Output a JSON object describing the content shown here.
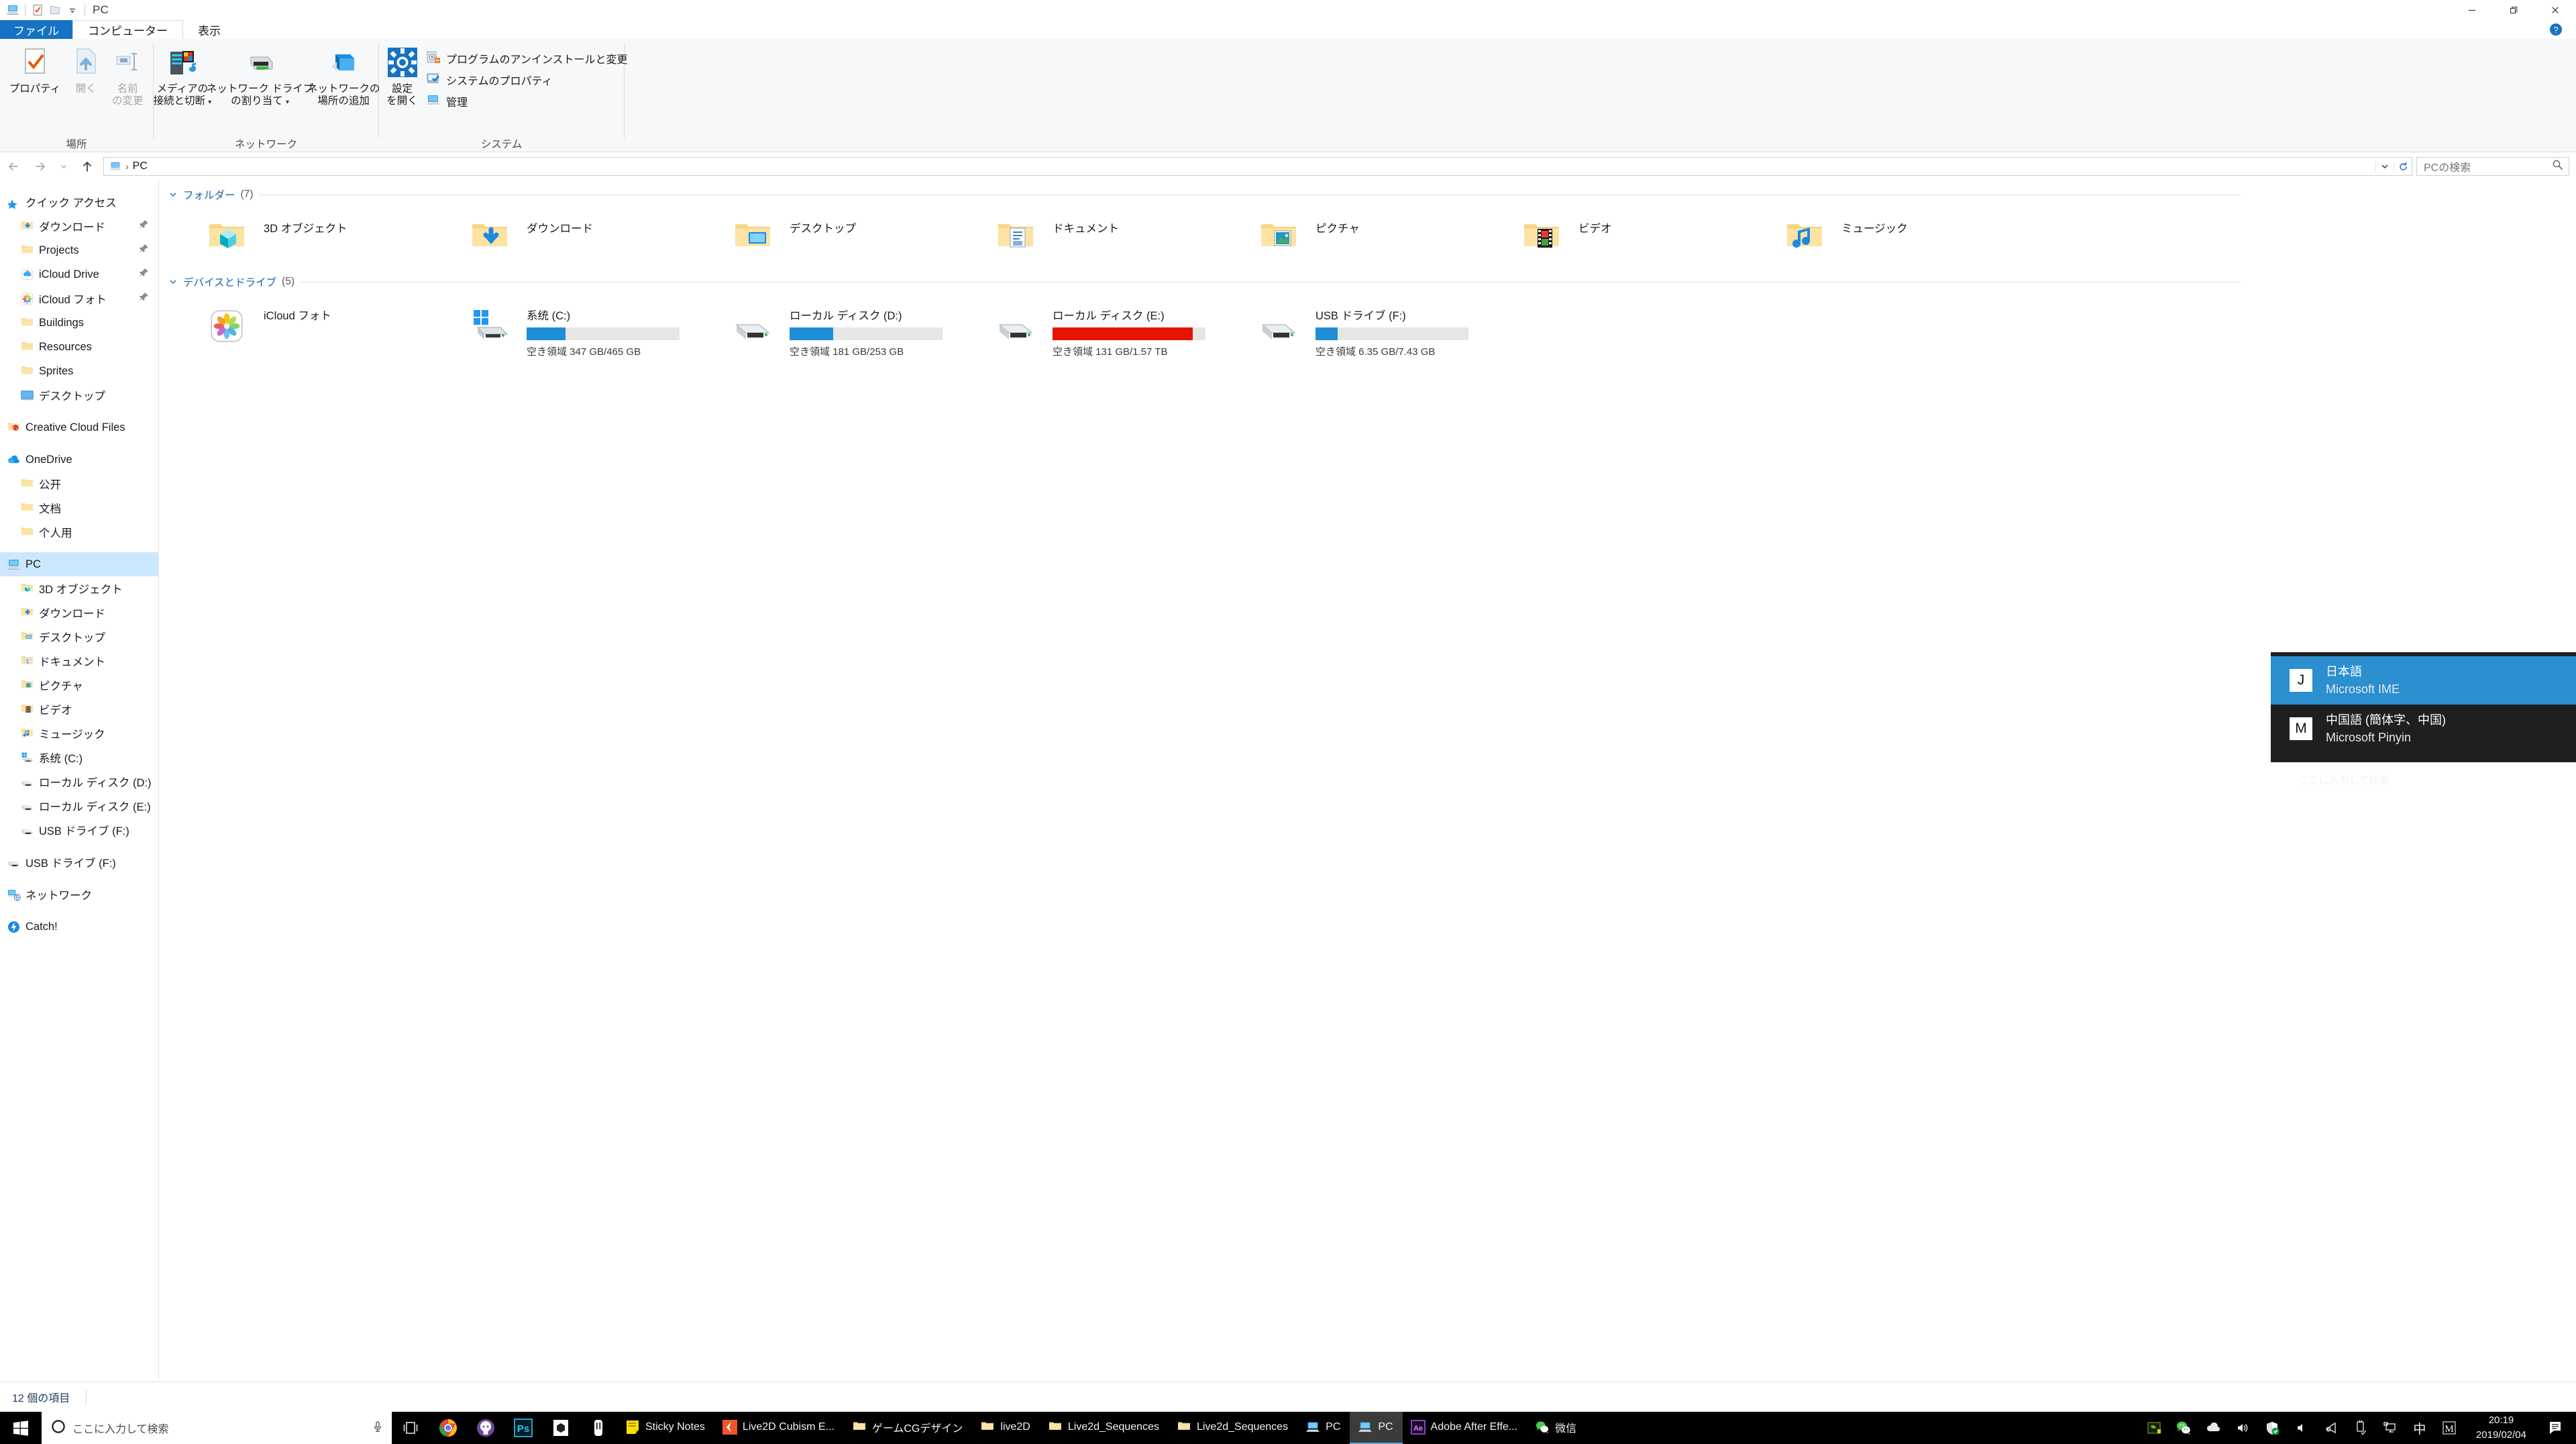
{
  "window": {
    "title": "PC",
    "quick_access_icons": [
      "pc-icon",
      "properties-icon",
      "folder-icon",
      "chevron-down-icon"
    ],
    "controls": {
      "minimize": "minimize-icon",
      "restore": "restore-icon",
      "close": "close-icon",
      "help": "help-icon"
    }
  },
  "ribbon": {
    "tabs": [
      {
        "label": "ファイル",
        "kind": "file"
      },
      {
        "label": "コンピューター",
        "kind": "active"
      },
      {
        "label": "表示",
        "kind": "normal"
      }
    ],
    "groups": [
      {
        "name": "場所",
        "buttons": [
          {
            "label_l1": "プロパティ",
            "label_l2": "",
            "icon": "properties-icon",
            "disabled": false
          },
          {
            "label_l1": "開く",
            "label_l2": "",
            "icon": "open-icon",
            "disabled": true
          },
          {
            "label_l1": "名前",
            "label_l2": "の変更",
            "icon": "rename-icon",
            "disabled": true
          }
        ]
      },
      {
        "name": "ネットワーク",
        "buttons": [
          {
            "label_l1": "メディアの",
            "label_l2": "接続と切断",
            "icon": "media-server-icon",
            "dropdown": true
          },
          {
            "label_l1": "ネットワーク ドライブ",
            "label_l2": "の割り当て",
            "icon": "network-drive-icon",
            "dropdown": true
          },
          {
            "label_l1": "ネットワークの",
            "label_l2": "場所の追加",
            "icon": "add-network-location-icon",
            "dropdown": false
          }
        ]
      },
      {
        "name": "システム",
        "big_button": {
          "label_l1": "設定",
          "label_l2": "を開く",
          "icon": "settings-gear-icon"
        },
        "small_buttons": [
          {
            "label": "プログラムのアンインストールと変更",
            "icon": "uninstall-program-icon"
          },
          {
            "label": "システムのプロパティ",
            "icon": "system-properties-icon"
          },
          {
            "label": "管理",
            "icon": "manage-computer-icon"
          }
        ]
      }
    ]
  },
  "addressbar": {
    "back": "back-arrow-icon",
    "forward": "forward-arrow-icon",
    "recent": "chevron-down-icon",
    "up": "up-arrow-icon",
    "breadcrumb_icon": "pc-icon",
    "breadcrumb": [
      "PC"
    ],
    "separator": "›",
    "dropdown": "chevron-down-icon",
    "refresh": "refresh-icon",
    "search_placeholder": "PCの検索",
    "search_icon": "search-icon"
  },
  "navpane": {
    "items": [
      {
        "label": "クイック アクセス",
        "icon": "quick-access-star-icon",
        "level": 0,
        "pinned": false,
        "selected": false
      },
      {
        "label": "ダウンロード",
        "icon": "downloads-folder-icon",
        "level": 1,
        "pinned": true,
        "selected": false
      },
      {
        "label": "Projects",
        "icon": "folder-icon",
        "level": 1,
        "pinned": true,
        "selected": false
      },
      {
        "label": "iCloud Drive",
        "icon": "icloud-drive-icon",
        "level": 1,
        "pinned": true,
        "selected": false
      },
      {
        "label": "iCloud フォト",
        "icon": "icloud-photos-icon",
        "level": 1,
        "pinned": true,
        "selected": false
      },
      {
        "label": "Buildings",
        "icon": "folder-icon",
        "level": 1,
        "pinned": false,
        "selected": false
      },
      {
        "label": "Resources",
        "icon": "folder-icon",
        "level": 1,
        "pinned": false,
        "selected": false
      },
      {
        "label": "Sprites",
        "icon": "folder-icon",
        "level": 1,
        "pinned": false,
        "selected": false
      },
      {
        "label": "デスクトップ",
        "icon": "desktop-icon",
        "level": 1,
        "pinned": false,
        "selected": false
      },
      {
        "label": "__GAP__",
        "icon": "",
        "level": 0,
        "pinned": false,
        "selected": false
      },
      {
        "label": "Creative Cloud Files",
        "icon": "creative-cloud-icon",
        "level": 0,
        "pinned": false,
        "selected": false
      },
      {
        "label": "__GAP__",
        "icon": "",
        "level": 0,
        "pinned": false,
        "selected": false
      },
      {
        "label": "OneDrive",
        "icon": "onedrive-icon",
        "level": 0,
        "pinned": false,
        "selected": false
      },
      {
        "label": "公开",
        "icon": "folder-icon",
        "level": 1,
        "pinned": false,
        "selected": false
      },
      {
        "label": "文档",
        "icon": "folder-icon",
        "level": 1,
        "pinned": false,
        "selected": false
      },
      {
        "label": "个人用",
        "icon": "folder-icon",
        "level": 1,
        "pinned": false,
        "selected": false
      },
      {
        "label": "__GAP__",
        "icon": "",
        "level": 0,
        "pinned": false,
        "selected": false
      },
      {
        "label": "PC",
        "icon": "pc-icon",
        "level": 0,
        "pinned": false,
        "selected": true
      },
      {
        "label": "3D オブジェクト",
        "icon": "3d-objects-icon",
        "level": 1,
        "pinned": false,
        "selected": false
      },
      {
        "label": "ダウンロード",
        "icon": "downloads-folder-icon",
        "level": 1,
        "pinned": false,
        "selected": false
      },
      {
        "label": "デスクトップ",
        "icon": "desktop-folder-icon",
        "level": 1,
        "pinned": false,
        "selected": false
      },
      {
        "label": "ドキュメント",
        "icon": "documents-folder-icon",
        "level": 1,
        "pinned": false,
        "selected": false
      },
      {
        "label": "ピクチャ",
        "icon": "pictures-folder-icon",
        "level": 1,
        "pinned": false,
        "selected": false
      },
      {
        "label": "ビデオ",
        "icon": "videos-folder-icon",
        "level": 1,
        "pinned": false,
        "selected": false
      },
      {
        "label": "ミュージック",
        "icon": "music-folder-icon",
        "level": 1,
        "pinned": false,
        "selected": false
      },
      {
        "label": "系统 (C:)",
        "icon": "system-drive-icon",
        "level": 1,
        "pinned": false,
        "selected": false
      },
      {
        "label": "ローカル ディスク (D:)",
        "icon": "drive-icon",
        "level": 1,
        "pinned": false,
        "selected": false
      },
      {
        "label": "ローカル ディスク (E:)",
        "icon": "drive-icon",
        "level": 1,
        "pinned": false,
        "selected": false
      },
      {
        "label": "USB ドライブ (F:)",
        "icon": "drive-icon",
        "level": 1,
        "pinned": false,
        "selected": false
      },
      {
        "label": "__GAP__",
        "icon": "",
        "level": 0,
        "pinned": false,
        "selected": false
      },
      {
        "label": "USB ドライブ (F:)",
        "icon": "drive-icon",
        "level": 0,
        "pinned": false,
        "selected": false
      },
      {
        "label": "__GAP__",
        "icon": "",
        "level": 0,
        "pinned": false,
        "selected": false
      },
      {
        "label": "ネットワーク",
        "icon": "network-icon",
        "level": 0,
        "pinned": false,
        "selected": false
      },
      {
        "label": "__GAP__",
        "icon": "",
        "level": 0,
        "pinned": false,
        "selected": false
      },
      {
        "label": "Catch!",
        "icon": "catch-icon",
        "level": 0,
        "pinned": false,
        "selected": false
      }
    ]
  },
  "filepane": {
    "groups": [
      {
        "title": "フォルダー",
        "count": "(7)",
        "chevron": "chevron-down-icon",
        "items": [
          {
            "name": "3D オブジェクト",
            "icon": "3d-objects-folder-icon",
            "type": "folder"
          },
          {
            "name": "ダウンロード",
            "icon": "downloads-folder-icon",
            "type": "folder"
          },
          {
            "name": "デスクトップ",
            "icon": "desktop-folder-icon",
            "type": "folder"
          },
          {
            "name": "ドキュメント",
            "icon": "documents-folder-icon",
            "type": "folder"
          },
          {
            "name": "ピクチャ",
            "icon": "pictures-folder-icon",
            "type": "folder"
          },
          {
            "name": "ビデオ",
            "icon": "videos-folder-icon",
            "type": "folder"
          },
          {
            "name": "ミュージック",
            "icon": "music-folder-icon",
            "type": "folder"
          }
        ]
      },
      {
        "title": "デバイスとドライブ",
        "count": "(5)",
        "chevron": "chevron-down-icon",
        "items": [
          {
            "name": "iCloud フォト",
            "icon": "icloud-photos-icon",
            "type": "device"
          },
          {
            "name": "系统 (C:)",
            "icon": "system-drive-icon",
            "type": "drive",
            "free_label": "空き領域 347 GB/465 GB",
            "used_percent": 25.4,
            "bar_color": "#1e8fd5"
          },
          {
            "name": "ローカル ディスク (D:)",
            "icon": "drive-icon",
            "type": "drive",
            "free_label": "空き領域 181 GB/253 GB",
            "used_percent": 28.5,
            "bar_color": "#1e8fd5"
          },
          {
            "name": "ローカル ディスク (E:)",
            "icon": "drive-icon",
            "type": "drive",
            "free_label": "空き領域 131 GB/1.57 TB",
            "used_percent": 91.7,
            "bar_color": "#e51400"
          },
          {
            "name": "USB ドライブ (F:)",
            "icon": "drive-icon",
            "type": "drive",
            "free_label": "空き領域 6.35 GB/7.43 GB",
            "used_percent": 14.5,
            "bar_color": "#1e8fd5"
          }
        ]
      }
    ]
  },
  "statusbar": {
    "item_count": "12 個の項目"
  },
  "ime_flyout": {
    "items": [
      {
        "badge": "J",
        "line1": "日本語",
        "line2": "Microsoft IME",
        "selected": true
      },
      {
        "badge": "M",
        "line1": "中国語 (簡体字、中国)",
        "line2": "Microsoft Pinyin",
        "selected": false
      }
    ],
    "ghost_text": "ここに入力して検索"
  },
  "taskbar": {
    "start_icon": "windows-start-icon",
    "search_placeholder": "ここに入力して検索",
    "cortana_icon": "cortana-circle-icon",
    "mic_icon": "microphone-icon",
    "taskview_icon": "task-view-icon",
    "pinned": [
      {
        "name": "chrome-icon"
      },
      {
        "name": "github-desktop-icon"
      },
      {
        "name": "photoshop-icon"
      },
      {
        "name": "unity-icon"
      },
      {
        "name": "clip-studio-icon"
      }
    ],
    "windows": [
      {
        "label": "Sticky Notes",
        "icon": "sticky-notes-icon",
        "active": false
      },
      {
        "label": "Live2D Cubism E...",
        "icon": "live2d-cubism-icon",
        "active": false
      },
      {
        "label": "ゲームCGデザイン",
        "icon": "folder-icon",
        "active": false
      },
      {
        "label": "live2D",
        "icon": "folder-icon",
        "active": false
      },
      {
        "label": "Live2d_Sequences",
        "icon": "folder-icon",
        "active": false
      },
      {
        "label": "Live2d_Sequences",
        "icon": "folder-icon",
        "active": false
      },
      {
        "label": "PC",
        "icon": "pc-icon",
        "active": false
      },
      {
        "label": "PC",
        "icon": "pc-icon",
        "active": true
      },
      {
        "label": "Adobe After Effe...",
        "icon": "after-effects-icon",
        "active": false
      },
      {
        "label": "微信",
        "icon": "wechat-icon",
        "active": false
      }
    ],
    "tray": [
      "nvidia-icon",
      "wechat-tray-icon",
      "onedrive-cloud-icon",
      "volume-icon",
      "windows-security-icon",
      "speaker-icon",
      "realtek-audio-icon",
      "safely-remove-usb-icon",
      "network-monitor-icon",
      "ime-mode-chinese-icon",
      "ime-pinyin-m-icon"
    ],
    "clock": {
      "time": "20:19",
      "date": "2019/02/04"
    },
    "action_center_icon": "action-center-icon"
  }
}
